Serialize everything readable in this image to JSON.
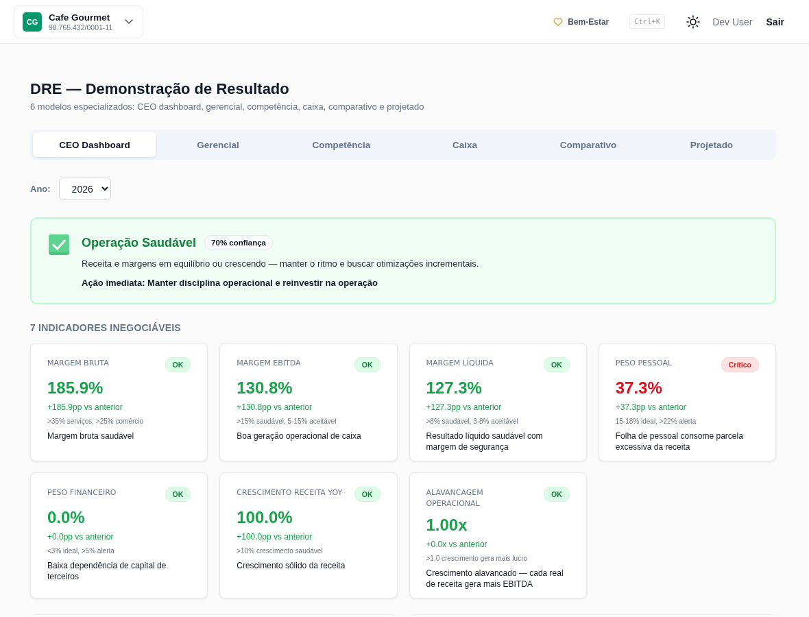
{
  "header": {
    "company": {
      "initials": "CG",
      "name": "Cafe Gourmet",
      "cnpj": "98.765.432/0001-11"
    },
    "wellbeing": "Bem-Estar",
    "shortcut": "Ctrl+K",
    "user": "Dev User",
    "logout": "Sair"
  },
  "page": {
    "title": "DRE — Demonstração de Resultado",
    "subtitle": "6 modelos especializados: CEO dashboard, gerencial, competência, caixa, comparativo e projetado"
  },
  "tabs": [
    {
      "label": "CEO Dashboard",
      "selected": true
    },
    {
      "label": "Gerencial",
      "selected": false
    },
    {
      "label": "Competência",
      "selected": false
    },
    {
      "label": "Caixa",
      "selected": false
    },
    {
      "label": "Comparativo",
      "selected": false
    },
    {
      "label": "Projetado",
      "selected": false
    }
  ],
  "year_filter": {
    "label": "Ano:",
    "value": "2026"
  },
  "status_banner": {
    "title": "Operação Saudável",
    "confidence": "70% confiança",
    "description": "Receita e margens em equilíbrio ou crescendo — manter o ritmo e buscar otimizações incrementais.",
    "action": "Ação imediata: Manter disciplina operacional e reinvestir na operação"
  },
  "indicators": {
    "heading": "7 INDICADORES INEGOCIÁVEIS",
    "cards": [
      {
        "label": "MARGEM BRUTA",
        "critical": false,
        "badge": "OK",
        "value": "185.9%",
        "delta": "+185.9pp vs anterior",
        "benchmark": ">35% serviços, >25% comércio",
        "description": "Margem bruta saudável"
      },
      {
        "label": "MARGEM EBITDA",
        "critical": false,
        "badge": "OK",
        "value": "130.8%",
        "delta": "+130.8pp vs anterior",
        "benchmark": ">15% saudável, 5-15% aceitável",
        "description": "Boa geração operacional de caixa"
      },
      {
        "label": "MARGEM LÍQUIDA",
        "critical": false,
        "badge": "OK",
        "value": "127.3%",
        "delta": "+127.3pp vs anterior",
        "benchmark": ">8% saudável, 3-8% aceitável",
        "description": "Resultado líquido saudável com margem de segurança"
      },
      {
        "label": "PESO PESSOAL",
        "critical": true,
        "badge": "Crítico",
        "value": "37.3%",
        "delta": "+37.3pp vs anterior",
        "benchmark": "15-18% ideal, >22% alerta",
        "description": "Folha de pessoal consome parcela excessiva da receita"
      },
      {
        "label": "PESO FINANCEIRO",
        "critical": false,
        "badge": "OK",
        "value": "0.0%",
        "delta": "+0.0pp vs anterior",
        "benchmark": "<3% ideal, >5% alerta",
        "description": "Baixa dependência de capital de terceiros"
      },
      {
        "label": "CRESCIMENTO RECEITA YOY",
        "critical": false,
        "badge": "OK",
        "value": "100.0%",
        "delta": "+100.0pp vs anterior",
        "benchmark": ">10% crescimento saudável",
        "description": "Crescimento sólido da receita"
      },
      {
        "label": "ALAVANCAGEM OPERACIONAL",
        "critical": false,
        "badge": "OK",
        "value": "1.00x",
        "delta": "+0.0x vs anterior",
        "benchmark": ">1.0 crescimento gera mais lucro",
        "description": "Crescimento alavancado — cada real de receita gera mais EBITDA"
      }
    ]
  }
}
